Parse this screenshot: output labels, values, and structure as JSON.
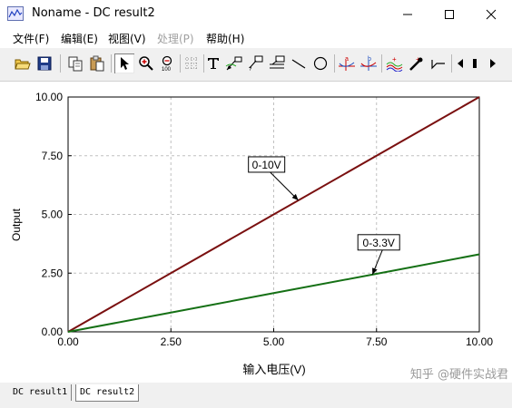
{
  "window": {
    "title": "Noname - DC result2"
  },
  "menu": {
    "items": [
      {
        "label": "文件(F)",
        "enabled": true
      },
      {
        "label": "编辑(E)",
        "enabled": true
      },
      {
        "label": "视图(V)",
        "enabled": true
      },
      {
        "label": "处理(P)",
        "enabled": false
      },
      {
        "label": "帮助(H)",
        "enabled": true
      }
    ]
  },
  "toolbar": {
    "buttons": [
      "open-icon",
      "save-icon",
      "copy-icon",
      "paste-icon",
      "pointer-icon",
      "zoom-in-icon",
      "zoom-100-icon",
      "grid-icon",
      "text-tool-icon",
      "arrow-annotation-icon",
      "curve-label-icon",
      "axis-label-icon",
      "line-tool-icon",
      "circle-tool-icon",
      "cursor-a-icon",
      "cursor-b-icon",
      "wave-icon",
      "pipette-icon",
      "step-icon",
      "scroll-left-icon",
      "scroll-right-icon"
    ]
  },
  "chart_data": {
    "type": "line",
    "xlabel": "输入电压(V)",
    "ylabel": "Output",
    "xlim": [
      0,
      10
    ],
    "ylim": [
      0,
      10
    ],
    "x_ticks": [
      "0.00",
      "2.50",
      "5.00",
      "7.50",
      "10.00"
    ],
    "y_ticks": [
      "0.00",
      "2.50",
      "5.00",
      "7.50",
      "10.00"
    ],
    "grid": true,
    "series": [
      {
        "name": "0-10V",
        "color": "#7a1010",
        "x": [
          0,
          10
        ],
        "y": [
          0,
          10
        ]
      },
      {
        "name": "0-3.3V",
        "color": "#157015",
        "x": [
          0,
          2.5,
          5,
          7.5,
          10
        ],
        "y": [
          0,
          0.82,
          1.65,
          2.47,
          3.3
        ]
      }
    ],
    "annotations": [
      {
        "text": "0-10V",
        "points_to": [
          5.6,
          5.6
        ]
      },
      {
        "text": "0-3.3V",
        "points_to": [
          7.4,
          2.44
        ]
      }
    ]
  },
  "tabs": [
    {
      "label": "DC result1",
      "active": false
    },
    {
      "label": "DC result2",
      "active": true
    }
  ],
  "watermark": "知乎 @硬件实战君",
  "colors": {
    "curve1": "#7a1010",
    "curve2": "#157015",
    "grid": "#c0c0c0"
  }
}
